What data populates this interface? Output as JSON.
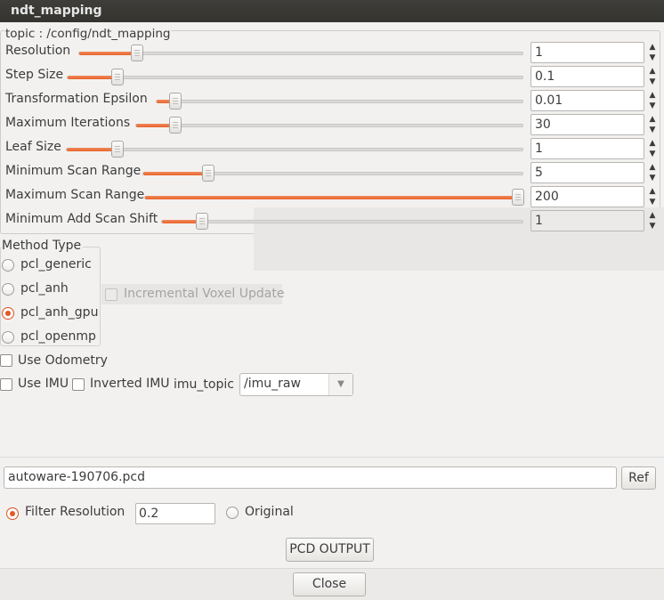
{
  "window": {
    "title": "ndt_mapping"
  },
  "group": {
    "title": "topic : /config/ndt_mapping"
  },
  "params": [
    {
      "label": "Resolution",
      "value": "1",
      "fill": 0.13
    },
    {
      "label": "Step Size",
      "value": "0.1",
      "fill": 0.11
    },
    {
      "label": "Transformation Epsilon",
      "value": "0.01",
      "fill": 0.05
    },
    {
      "label": "Maximum Iterations",
      "value": "30",
      "fill": 0.1
    },
    {
      "label": "Leaf Size",
      "value": "1",
      "fill": 0.11
    },
    {
      "label": "Minimum Scan Range",
      "value": "5",
      "fill": 0.17
    },
    {
      "label": "Maximum Scan Range",
      "value": "200",
      "fill": 1.0
    },
    {
      "label": "Minimum Add Scan Shift",
      "value": "1",
      "fill": 0.11
    }
  ],
  "method": {
    "title": "Method Type",
    "options": [
      "pcl_generic",
      "pcl_anh",
      "pcl_anh_gpu",
      "pcl_openmp"
    ],
    "selected": "pcl_anh_gpu"
  },
  "incremental_voxel_update": {
    "label": "Incremental Voxel Update",
    "checked": false,
    "enabled": false
  },
  "use_odometry": {
    "label": "Use Odometry",
    "checked": false
  },
  "use_imu": {
    "label": "Use IMU",
    "checked": false
  },
  "inverted_imu": {
    "label": "Inverted IMU",
    "checked": false
  },
  "imu_topic": {
    "label": "imu_topic",
    "value": "/imu_raw"
  },
  "output_file": {
    "value": "autoware-190706.pcd"
  },
  "ref_button": {
    "label": "Ref"
  },
  "filter_resolution": {
    "label": "Filter Resolution",
    "value": "0.2",
    "selected": true
  },
  "original": {
    "label": "Original",
    "selected": false
  },
  "pcd_output_button": {
    "label": "PCD OUTPUT"
  },
  "close_button": {
    "label": "Close"
  },
  "colors": {
    "accent": "#e8642c",
    "titlebar": "#3c3b37"
  }
}
